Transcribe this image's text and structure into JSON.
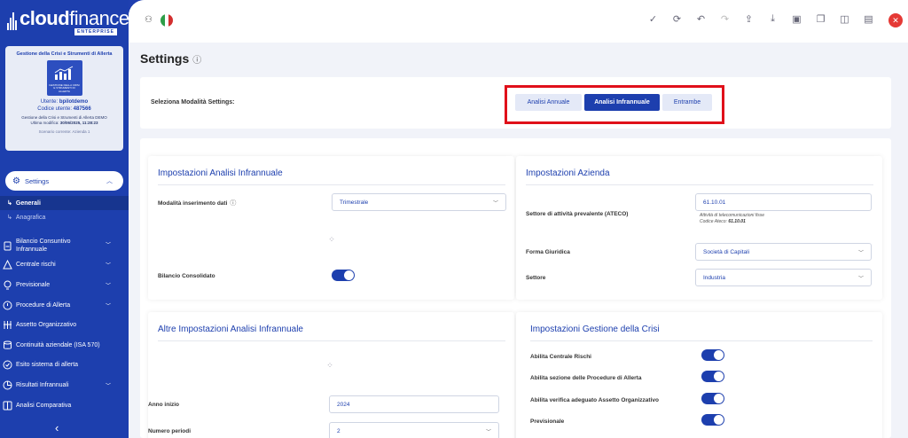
{
  "brand": {
    "name_bold": "cloud",
    "name_light": "finance",
    "edition": "ENTERPRISE"
  },
  "info_card": {
    "title": "Gestione della Crisi e Strumenti di Allerta",
    "image_caption": "GESTIONE DELLA CRISI E STRUMENTI DI ALLERTA",
    "user_label": "Utente:",
    "user_value": "bpilotdemo",
    "code_label": "Codice utente:",
    "code_value": "487566",
    "company": "Gestione della Crisi e Strumenti di Allerta DEMO",
    "last_modified_label": "Ultima modifica:",
    "last_modified_value": "30/06/2025, 11:28:23",
    "scenario": "Scenario corrente: Azienda 1"
  },
  "nav": {
    "settings_label": "Settings",
    "sub_items": [
      "Generali",
      "Anagrafica"
    ],
    "items": [
      {
        "label": "Bilancio Consuntivo Infrannuale",
        "icon": "document-icon",
        "chevron": true
      },
      {
        "label": "Centrale rischi",
        "icon": "warning-icon",
        "chevron": true
      },
      {
        "label": "Previsionale",
        "icon": "bulb-icon",
        "chevron": true
      },
      {
        "label": "Procedure di Allerta",
        "icon": "alert-circle-icon",
        "chevron": true
      },
      {
        "label": "Assetto Organizzativo",
        "icon": "org-chart-icon",
        "chevron": false
      },
      {
        "label": "Continuità aziendale (ISA 570)",
        "icon": "database-icon",
        "chevron": false
      },
      {
        "label": "Esito sistema di allerta",
        "icon": "check-circle-icon",
        "chevron": false
      },
      {
        "label": "Risultati Infrannuali",
        "icon": "pie-chart-icon",
        "chevron": true
      },
      {
        "label": "Analisi Comparativa",
        "icon": "columns-icon",
        "chevron": false
      }
    ]
  },
  "toolbar": {
    "icons": [
      "check-icon",
      "refresh-icon",
      "undo-icon",
      "redo-icon",
      "upload-icon",
      "download-icon",
      "save-icon",
      "copy-icon",
      "panel-icon",
      "calendar-icon"
    ]
  },
  "page": {
    "title": "Settings"
  },
  "mode": {
    "label": "Seleziona Modalità Settings:",
    "buttons": [
      "Analisi Annuale",
      "Analisi Infrannuale",
      "Entrambe"
    ],
    "active": "Analisi Infrannuale"
  },
  "infrannuale": {
    "title": "Impostazioni Analisi Infrannuale",
    "modalita_label": "Modalità inserimento dati",
    "modalita_value": "Trimestrale",
    "consolidato_label": "Bilancio Consolidato",
    "consolidato_on": true
  },
  "azienda": {
    "title": "Impostazioni Azienda",
    "ateco_label": "Settore di attività prevalente (ATECO)",
    "ateco_value": "61.10.01",
    "ateco_desc": "Attività di telecomunicazioni fisse",
    "ateco_code_label": "Codice Ateco:",
    "ateco_code_value": "61.10.01",
    "forma_label": "Forma Giuridica",
    "forma_value": "Società di Capitali",
    "settore_label": "Settore",
    "settore_value": "Industria"
  },
  "altre": {
    "title": "Altre Impostazioni Analisi Infrannuale",
    "anno_label": "Anno inizio",
    "anno_value": "2024",
    "periodi_label": "Numero periodi",
    "periodi_value": "2"
  },
  "crisi": {
    "title": "Impostazioni Gestione della Crisi",
    "items": [
      {
        "label": "Abilita Centrale Rischi",
        "on": true
      },
      {
        "label": "Abilita sezione delle Procedure di Allerta",
        "on": true
      },
      {
        "label": "Abilita verifica adeguato Assetto Organizzativo",
        "on": true
      },
      {
        "label": "Previsionale",
        "on": true
      }
    ]
  },
  "colors": {
    "brand": "#1d3fae",
    "highlight": "#e0101a",
    "close": "#e53935"
  }
}
